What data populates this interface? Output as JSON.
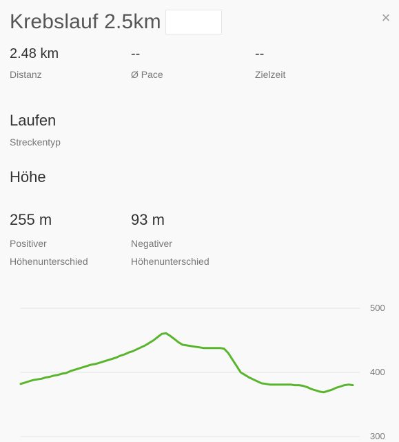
{
  "route": {
    "title": "Krebslauf 2.5km",
    "close_symbol": "×"
  },
  "stats": [
    {
      "value": "2.48 km",
      "label": "Distanz"
    },
    {
      "value": "--",
      "label": "Ø Pace"
    },
    {
      "value": "--",
      "label": "Zielzeit"
    }
  ],
  "route_type": {
    "value": "Laufen",
    "label": "Streckentyp"
  },
  "elevation_heading": "Höhe",
  "elevation": [
    {
      "value": "255 m",
      "label_line1": "Positiver",
      "label_line2": "Höhenunterschied"
    },
    {
      "value": "93 m",
      "label_line1": "Negativer",
      "label_line2": "Höhenunterschied"
    }
  ],
  "colors": {
    "line": "#5ab52e",
    "grid": "#e4e4e4"
  },
  "chart_data": {
    "type": "line",
    "title": "",
    "xlabel": "",
    "ylabel": "",
    "ylim": [
      300,
      500
    ],
    "yticks": [
      "500",
      "400",
      "300"
    ],
    "grid": true,
    "series": [
      {
        "values": [
          382,
          384,
          386,
          388,
          389,
          390,
          392,
          393,
          395,
          396,
          398,
          399,
          402,
          404,
          406,
          408,
          410,
          412,
          413,
          415,
          417,
          419,
          421,
          423,
          426,
          428,
          431,
          433,
          436,
          439,
          442,
          446,
          450,
          455,
          460,
          461,
          457,
          452,
          447,
          443,
          442,
          441,
          440,
          439,
          438,
          438,
          438,
          438,
          438,
          437,
          430,
          420,
          410,
          400,
          396,
          392,
          389,
          386,
          383,
          382,
          381,
          381,
          381,
          381,
          381,
          381,
          380,
          380,
          379,
          377,
          374,
          372,
          370,
          369,
          371,
          373,
          376,
          378,
          380,
          381,
          380
        ]
      }
    ]
  }
}
